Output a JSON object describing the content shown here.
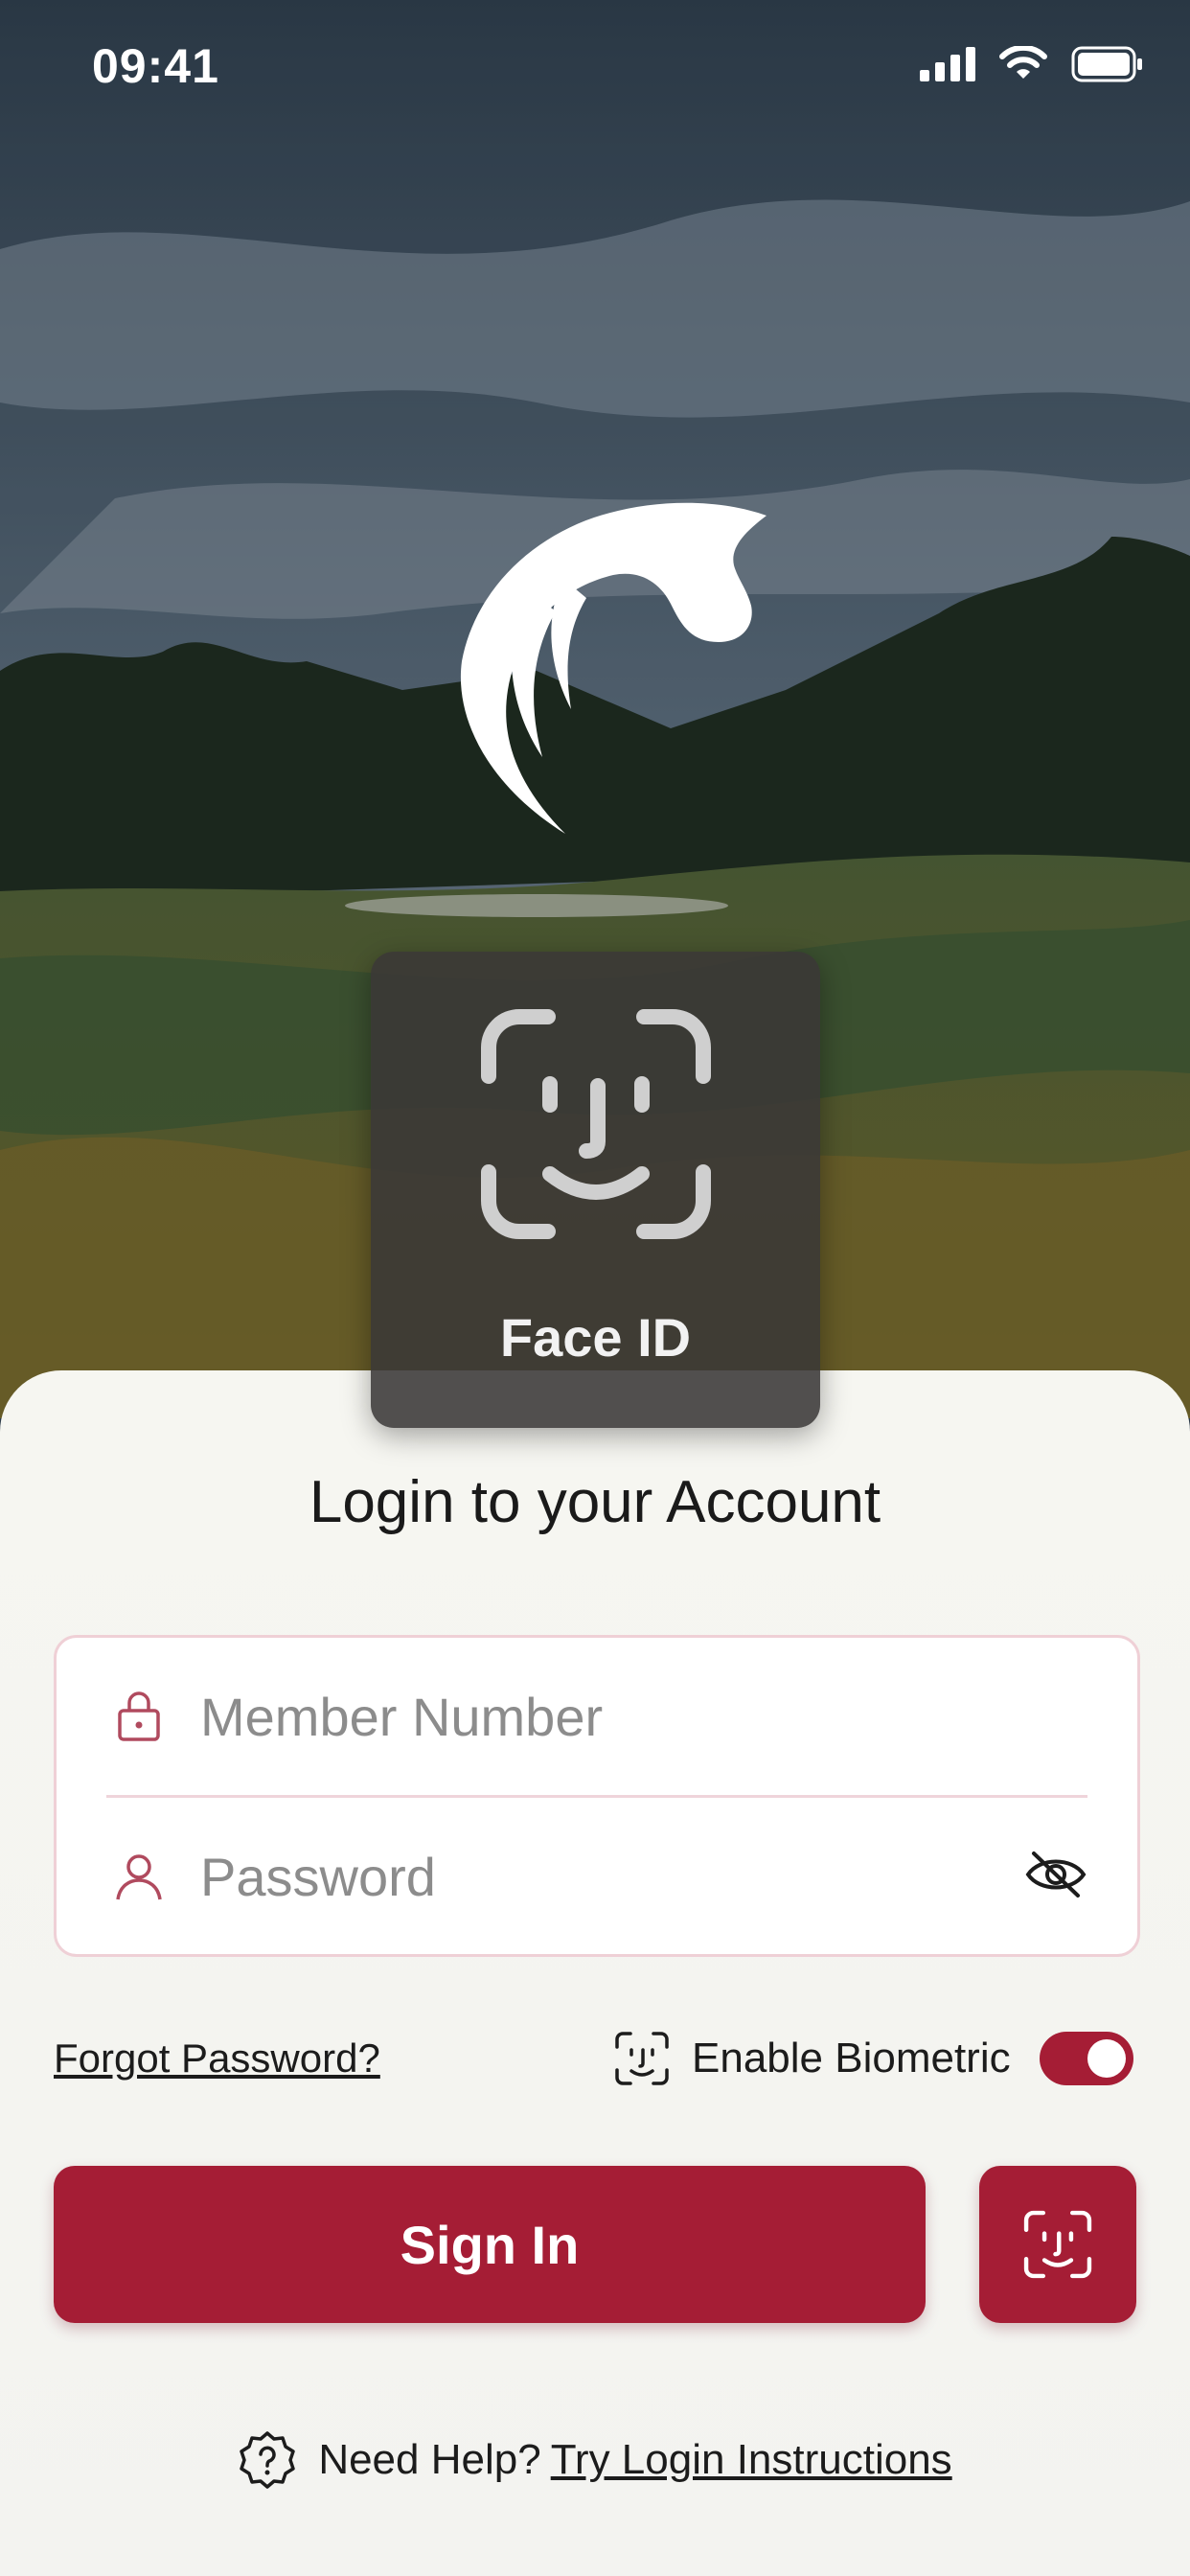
{
  "status_bar": {
    "time": "09:41"
  },
  "face_id_hud": {
    "label": "Face ID"
  },
  "login": {
    "title": "Login to your Account",
    "member_number_placeholder": "Member Number",
    "password_placeholder": "Password",
    "forgot_password": "Forgot Password?",
    "enable_biometric_label": "Enable Biometric",
    "enable_biometric_on": true,
    "sign_in_label": "Sign In"
  },
  "help": {
    "prefix": "Need Help?",
    "link": "Try Login Instructions"
  },
  "icons": {
    "logo": "horse-head-logo",
    "lock": "lock-icon",
    "user": "user-icon",
    "eye_off": "eye-slash-icon",
    "face_id": "face-id-icon",
    "help": "question-badge-icon"
  },
  "colors": {
    "accent": "#a51d35",
    "field_border": "#efd0d6",
    "sheet_bg": "#f5f5f1"
  }
}
